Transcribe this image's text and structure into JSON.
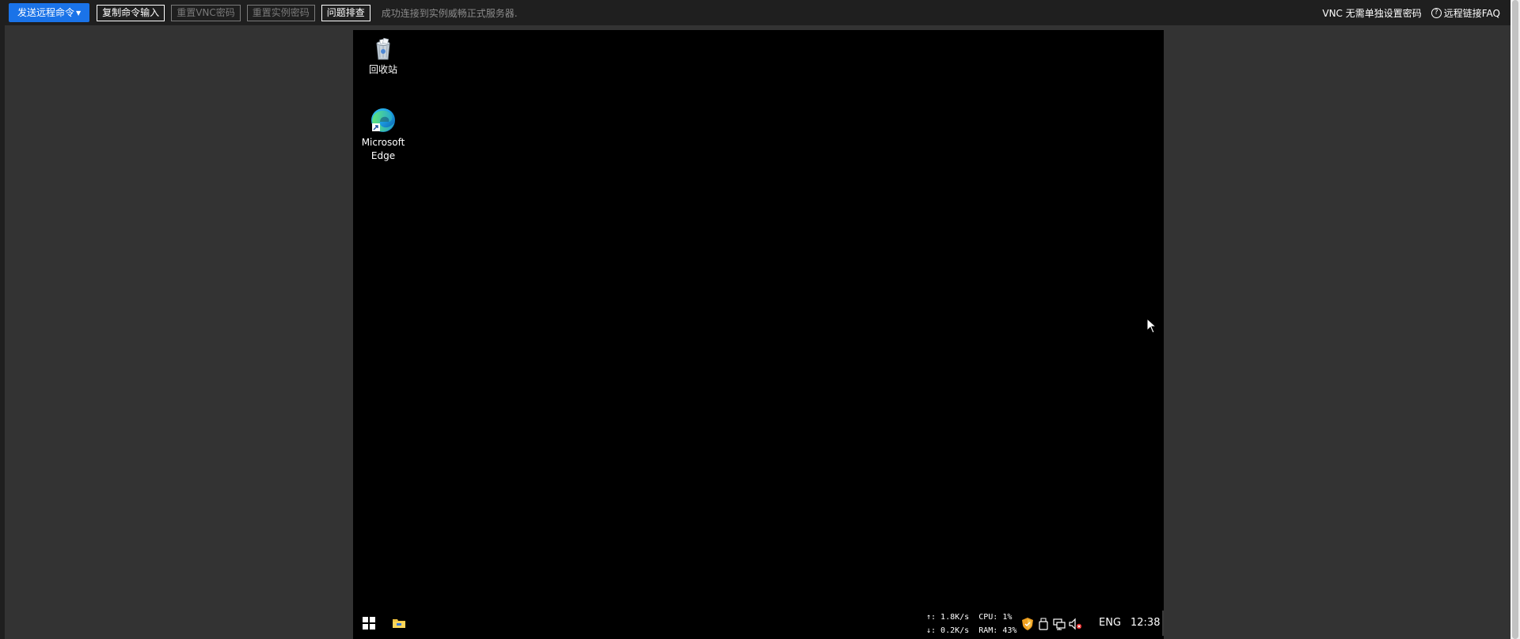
{
  "toolbar": {
    "send_command": "发送远程命令",
    "copy_input": "复制命令输入",
    "reset_vnc": "重置VNC密码",
    "reset_instance": "重置实例密码",
    "troubleshoot": "问题排查",
    "status_message": "成功连接到实例威畅正式服务器.",
    "vnc_password": "VNC 无需单独设置密码",
    "faq": "远程链接FAQ",
    "help_icon_glyph": "?"
  },
  "desktop": {
    "icons": [
      {
        "label": "回收站",
        "icon": "recycle-bin-icon"
      },
      {
        "label": "Microsoft Edge",
        "icon": "edge-icon"
      }
    ]
  },
  "taskbar": {
    "net_up": "↑: 1.8K/s",
    "net_down": "↓: 0.2K/s",
    "cpu": "CPU: 1%",
    "ram": "RAM: 43%",
    "language": "ENG",
    "time": "12:38"
  },
  "colors": {
    "toolbar_bg": "#1f1f1f",
    "primary": "#1a73e8",
    "page_bg": "#333333",
    "desktop_bg": "#000000"
  }
}
